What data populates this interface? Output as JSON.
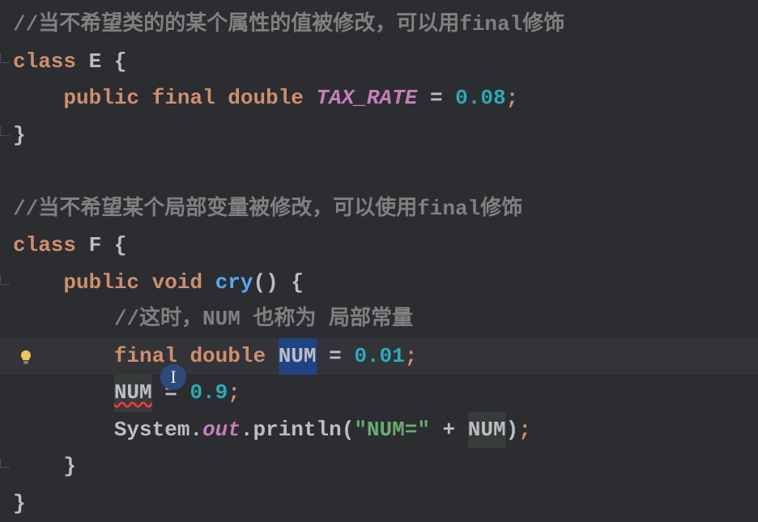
{
  "lines": {
    "comment1": "//当不希望类的的某个属性的值被修改，可以用final修饰",
    "class_keyword": "class",
    "class_E": "E",
    "public_keyword": "public",
    "final_keyword": "final",
    "double_keyword": "double",
    "tax_rate_name": "TAX_RATE",
    "tax_rate_value": "0.08",
    "comment2": "//当不希望某个局部变量被修改，可以使用final修饰",
    "class_F": "F",
    "void_keyword": "void",
    "method_cry": "cry",
    "comment3": "//这时，NUM 也称为 局部常量",
    "num_name": "NUM",
    "num_value1": "0.01",
    "num_value2": "0.9",
    "system_class": "System",
    "out_field": "out",
    "println_method": "println",
    "string_literal": "\"NUM=\"",
    "plus_op": "+",
    "equals_op": "=",
    "semicolon": ";",
    "open_brace": "{",
    "close_brace": "}",
    "open_paren": "(",
    "close_paren": ")"
  }
}
